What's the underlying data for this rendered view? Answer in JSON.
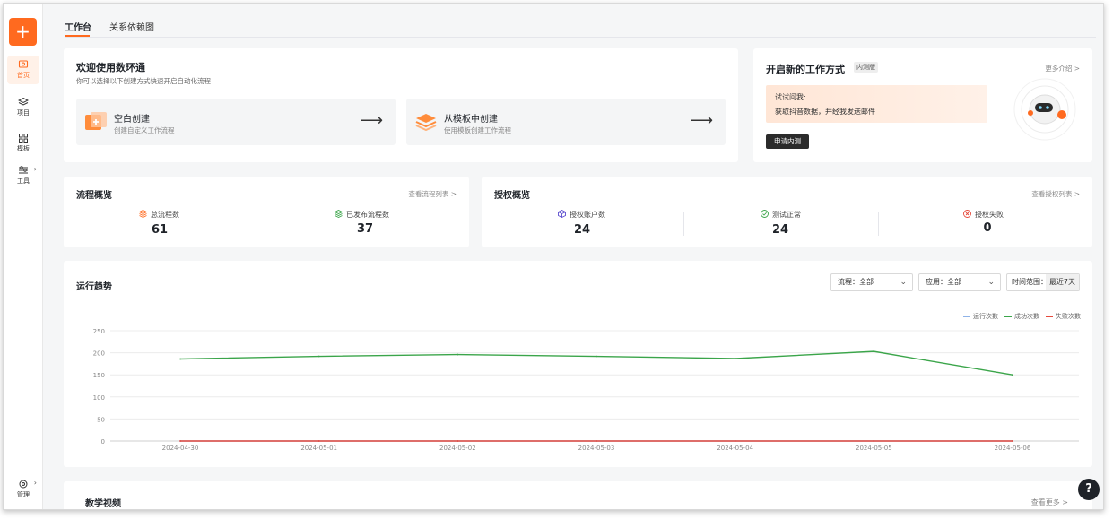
{
  "sidebar": {
    "add_symbol": "+",
    "items": [
      {
        "label": "首页"
      },
      {
        "label": "项目"
      },
      {
        "label": "模板"
      },
      {
        "label": "工具"
      }
    ],
    "bottom_label": "管理"
  },
  "tabs": [
    {
      "label": "工作台"
    },
    {
      "label": "关系依赖图"
    }
  ],
  "welcome": {
    "title": "欢迎使用数环通",
    "subtitle": "你可以选择以下创建方式快速开启自动化流程",
    "options": [
      {
        "title": "空白创建",
        "desc": "创建自定义工作流程"
      },
      {
        "title": "从模板中创建",
        "desc": "使用模板创建工作流程"
      }
    ]
  },
  "promo": {
    "title": "开启新的工作方式",
    "badge": "内测版",
    "more": "更多介绍 >",
    "prompt_label": "试试问我:",
    "prompt_text": "获取抖音数据，并经我发送邮件",
    "button": "申请内测"
  },
  "flow_overview": {
    "title": "流程概览",
    "link": "查看流程列表 >",
    "stats": [
      {
        "label": "总流程数",
        "value": "61"
      },
      {
        "label": "已发布流程数",
        "value": "37"
      }
    ]
  },
  "auth_overview": {
    "title": "授权概览",
    "link": "查看授权列表 >",
    "stats": [
      {
        "label": "授权账户数",
        "value": "24"
      },
      {
        "label": "测试正常",
        "value": "24"
      },
      {
        "label": "授权失败",
        "value": "0"
      }
    ]
  },
  "trend": {
    "title": "运行趋势",
    "filters": [
      {
        "label": "流程：全部"
      },
      {
        "label": "应用：全部"
      }
    ],
    "time_label": "时间范围：",
    "time_value": "最近7天"
  },
  "chart_data": {
    "type": "line",
    "x": [
      "2024-04-30",
      "2024-05-01",
      "2024-05-02",
      "2024-05-03",
      "2024-05-04",
      "2024-05-05",
      "2024-05-06"
    ],
    "ylim": [
      0,
      250
    ],
    "yticks": [
      "250",
      "200",
      "150",
      "100",
      "50",
      "0"
    ],
    "legend_position": "top-right",
    "grid": true,
    "series": [
      {
        "name": "运行次数",
        "color": "#8fb3e8",
        "values": [
          0,
          0,
          0,
          0,
          0,
          0,
          0
        ]
      },
      {
        "name": "成功次数",
        "color": "#3ba54a",
        "values": [
          186,
          192,
          196,
          192,
          187,
          203,
          150
        ]
      },
      {
        "name": "失败次数",
        "color": "#e64a3c",
        "values": [
          0,
          0,
          0,
          0,
          0,
          0,
          0
        ]
      }
    ]
  },
  "video": {
    "title": "教学视频",
    "more": "查看更多 >"
  },
  "help_symbol": "?"
}
